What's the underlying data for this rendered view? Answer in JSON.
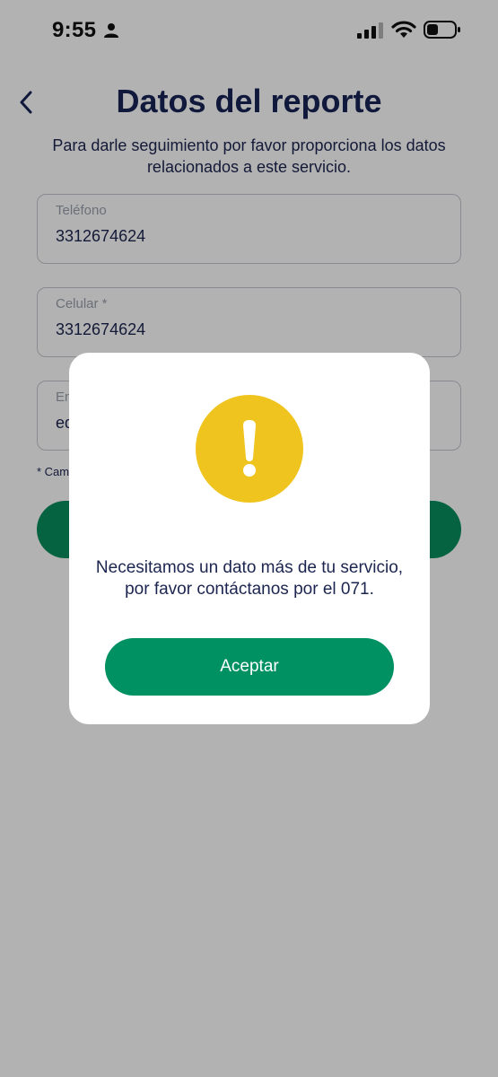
{
  "status_bar": {
    "time": "9:55"
  },
  "header": {
    "title": "Datos del reporte",
    "subtitle": "Para darle seguimiento por favor proporciona los datos relacionados a este servicio."
  },
  "form": {
    "fields": [
      {
        "label": "Teléfono",
        "value": "3312674624"
      },
      {
        "label": "Celular *",
        "value": "3312674624"
      },
      {
        "label": "Em",
        "value": "ed"
      }
    ],
    "required_note": "* Cam"
  },
  "modal": {
    "icon": "warning-icon",
    "icon_color": "#F0C41F",
    "message": "Necesitamos un dato más de tu servicio, por favor contáctanos por el 071.",
    "accept_label": "Aceptar",
    "accent_color": "#009162"
  }
}
